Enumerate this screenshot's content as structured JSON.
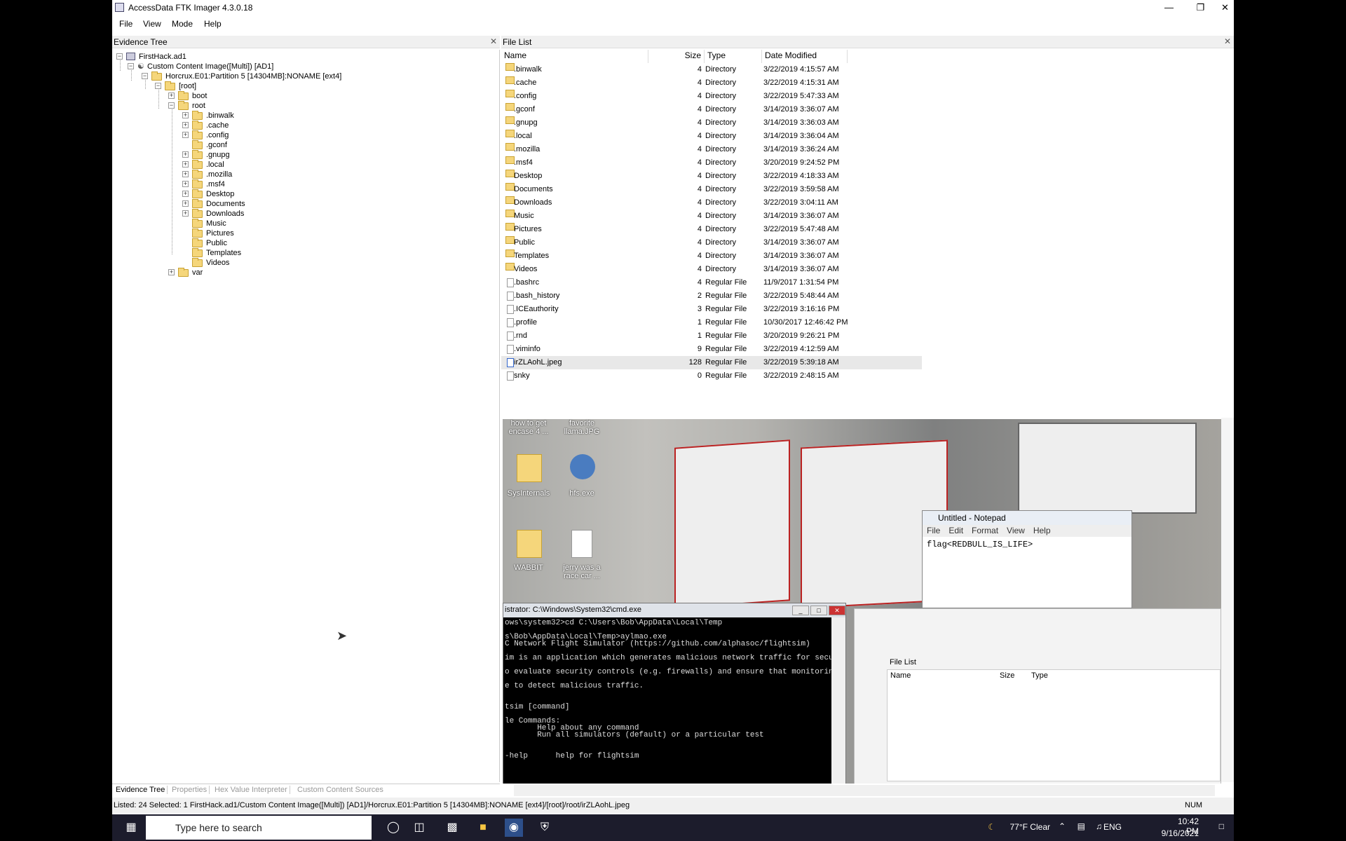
{
  "app": {
    "title": "AccessData FTK Imager 4.3.0.18",
    "menu": [
      "File",
      "View",
      "Mode",
      "Help"
    ]
  },
  "evidence_tree": {
    "header": "Evidence Tree",
    "nodes": [
      {
        "label": "FirstHack.ad1"
      },
      {
        "label": "Custom Content Image([Multi]) [AD1]"
      },
      {
        "label": "Horcrux.E01:Partition 5 [14304MB]:NONAME [ext4]"
      },
      {
        "label": "[root]"
      },
      {
        "label": "boot"
      },
      {
        "label": "root"
      },
      {
        "label": ".binwalk"
      },
      {
        "label": ".cache"
      },
      {
        "label": ".config"
      },
      {
        "label": ".gconf"
      },
      {
        "label": ".gnupg"
      },
      {
        "label": ".local"
      },
      {
        "label": ".mozilla"
      },
      {
        "label": ".msf4"
      },
      {
        "label": "Desktop"
      },
      {
        "label": "Documents"
      },
      {
        "label": "Downloads"
      },
      {
        "label": "Music"
      },
      {
        "label": "Pictures"
      },
      {
        "label": "Public"
      },
      {
        "label": "Templates"
      },
      {
        "label": "Videos"
      },
      {
        "label": "var"
      }
    ],
    "tabs": [
      "Evidence Tree",
      "Properties",
      "Hex Value Interpreter",
      "Custom Content Sources"
    ]
  },
  "file_list": {
    "header": "File List",
    "columns": [
      "Name",
      "Size",
      "Type",
      "Date Modified"
    ],
    "rows": [
      {
        "name": ".binwalk",
        "size": "4",
        "type": "Directory",
        "date": "3/22/2019 4:15:57 AM",
        "kind": "dir"
      },
      {
        "name": ".cache",
        "size": "4",
        "type": "Directory",
        "date": "3/22/2019 4:15:31 AM",
        "kind": "dir"
      },
      {
        "name": ".config",
        "size": "4",
        "type": "Directory",
        "date": "3/22/2019 5:47:33 AM",
        "kind": "dir"
      },
      {
        "name": ".gconf",
        "size": "4",
        "type": "Directory",
        "date": "3/14/2019 3:36:07 AM",
        "kind": "dir"
      },
      {
        "name": ".gnupg",
        "size": "4",
        "type": "Directory",
        "date": "3/14/2019 3:36:03 AM",
        "kind": "dir"
      },
      {
        "name": ".local",
        "size": "4",
        "type": "Directory",
        "date": "3/14/2019 3:36:04 AM",
        "kind": "dir"
      },
      {
        "name": ".mozilla",
        "size": "4",
        "type": "Directory",
        "date": "3/14/2019 3:36:24 AM",
        "kind": "dir"
      },
      {
        "name": ".msf4",
        "size": "4",
        "type": "Directory",
        "date": "3/20/2019 9:24:52 PM",
        "kind": "dir"
      },
      {
        "name": "Desktop",
        "size": "4",
        "type": "Directory",
        "date": "3/22/2019 4:18:33 AM",
        "kind": "dir"
      },
      {
        "name": "Documents",
        "size": "4",
        "type": "Directory",
        "date": "3/22/2019 3:59:58 AM",
        "kind": "dir"
      },
      {
        "name": "Downloads",
        "size": "4",
        "type": "Directory",
        "date": "3/22/2019 3:04:11 AM",
        "kind": "dir"
      },
      {
        "name": "Music",
        "size": "4",
        "type": "Directory",
        "date": "3/14/2019 3:36:07 AM",
        "kind": "dir"
      },
      {
        "name": "Pictures",
        "size": "4",
        "type": "Directory",
        "date": "3/22/2019 5:47:48 AM",
        "kind": "dir"
      },
      {
        "name": "Public",
        "size": "4",
        "type": "Directory",
        "date": "3/14/2019 3:36:07 AM",
        "kind": "dir"
      },
      {
        "name": "Templates",
        "size": "4",
        "type": "Directory",
        "date": "3/14/2019 3:36:07 AM",
        "kind": "dir"
      },
      {
        "name": "Videos",
        "size": "4",
        "type": "Directory",
        "date": "3/14/2019 3:36:07 AM",
        "kind": "dir"
      },
      {
        "name": ".bashrc",
        "size": "4",
        "type": "Regular File",
        "date": "11/9/2017 1:31:54 PM",
        "kind": "file"
      },
      {
        "name": ".bash_history",
        "size": "2",
        "type": "Regular File",
        "date": "3/22/2019 5:48:44 AM",
        "kind": "file"
      },
      {
        "name": ".ICEauthority",
        "size": "3",
        "type": "Regular File",
        "date": "3/22/2019 3:16:16 PM",
        "kind": "file"
      },
      {
        "name": ".profile",
        "size": "1",
        "type": "Regular File",
        "date": "10/30/2017 12:46:42 PM",
        "kind": "file"
      },
      {
        "name": ".rnd",
        "size": "1",
        "type": "Regular File",
        "date": "3/20/2019 9:26:21 PM",
        "kind": "file"
      },
      {
        "name": ".viminfo",
        "size": "9",
        "type": "Regular File",
        "date": "3/22/2019 4:12:59 AM",
        "kind": "file"
      },
      {
        "name": "irZLAohL.jpeg",
        "size": "128",
        "type": "Regular File",
        "date": "3/22/2019 5:39:18 AM",
        "kind": "img",
        "selected": true
      },
      {
        "name": "snky",
        "size": "0",
        "type": "Regular File",
        "date": "3/22/2019 2:48:15 AM",
        "kind": "file"
      }
    ]
  },
  "viewer": {
    "desktop_icons": [
      "how to get encase 4 ...",
      "favorite llama.JPG",
      "SysInternals",
      "hfs.exe",
      "WABBIT",
      "jerry was a race car ..."
    ],
    "notepad": {
      "title": "Untitled - Notepad",
      "menu": [
        "File",
        "Edit",
        "Format",
        "View",
        "Help"
      ],
      "text": "flag<REDBULL_IS_LIFE>"
    },
    "cmd": {
      "title": "istrator: C:\\Windows\\System32\\cmd.exe",
      "lines": [
        "ows\\system32>cd C:\\Users\\Bob\\AppData\\Local\\Temp",
        "",
        "s\\Bob\\AppData\\Local\\Temp>aylmao.exe",
        "C Network Flight Simulator (https://github.com/alphasoc/flightsim)",
        "",
        "im is an application which generates malicious network traffic for securi",
        "",
        "o evaluate security controls (e.g. firewalls) and ensure that monitoring",
        "",
        "e to detect malicious traffic.",
        "",
        "",
        "tsim [command]",
        "",
        "le Commands:",
        "       Help about any command",
        "       Run all simulators (default) or a particular test",
        "",
        "",
        "-help      help for flightsim"
      ]
    },
    "embedded_filelist": {
      "header": "File List",
      "columns": [
        "Name",
        "Size",
        "Type"
      ]
    }
  },
  "status": "Listed: 24  Selected: 1   FirstHack.ad1/Custom Content Image([Multi]) [AD1]/Horcrux.E01:Partition 5 [14304MB]:NONAME [ext4]/[root]/root/irZLAohL.jpeg",
  "status_num": "NUM",
  "taskbar": {
    "search_placeholder": "Type here to search",
    "weather": "77°F  Clear",
    "lang": "ENG",
    "time": "10:42 PM",
    "date": "9/16/2021"
  }
}
